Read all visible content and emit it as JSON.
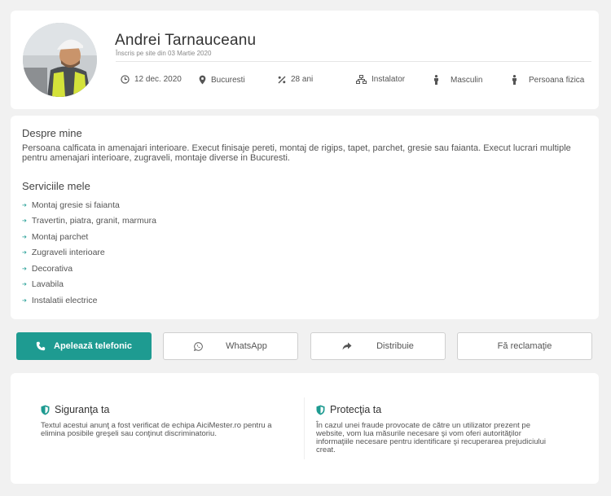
{
  "profile": {
    "name": "Andrei Tarnauceanu",
    "since": "Înscris pe site din 03 Martie 2020",
    "meta": {
      "date": "12 dec. 2020",
      "city": "Bucuresti",
      "age": "28 ani",
      "job": "Instalator",
      "gender": "Masculin",
      "person_type": "Persoana fizica"
    }
  },
  "about": {
    "title": "Despre mine",
    "text": "Persoana calficata in amenajari interioare. Execut finisaje pereti, montaj de rigips, tapet, parchet, gresie sau faianta. Execut lucrari multiple pentru amenajari interioare, zugraveli, montaje diverse in Bucuresti."
  },
  "services": {
    "title": "Serviciile mele",
    "items": [
      "Montaj gresie si faianta",
      "Travertin, piatra, granit, marmura",
      "Montaj parchet",
      "Zugraveli interioare",
      "Decorativa",
      "Lavabila",
      "Instalatii electrice"
    ]
  },
  "actions": {
    "call": "Apelează telefonic",
    "whatsapp": "WhatsApp",
    "share": "Distribuie",
    "report": "Fă reclamaţie"
  },
  "trust": {
    "safety_title": "Siguranţa ta",
    "safety_text": "Textul acestui anunţ a fost verificat de echipa AiciMester.ro pentru a elimina posibile greşeli sau conţinut discriminatoriu.",
    "protection_title": "Protecţia ta",
    "protection_text": "În cazul unei fraude provocate de către un utilizator prezent pe website, vom lua măsurile necesare şi vom oferi autorităţilor informaţiile necesare pentru identificare şi recuperarea prejudiciului creat."
  },
  "colors": {
    "accent": "#1e9b91",
    "icon": "#555555"
  }
}
